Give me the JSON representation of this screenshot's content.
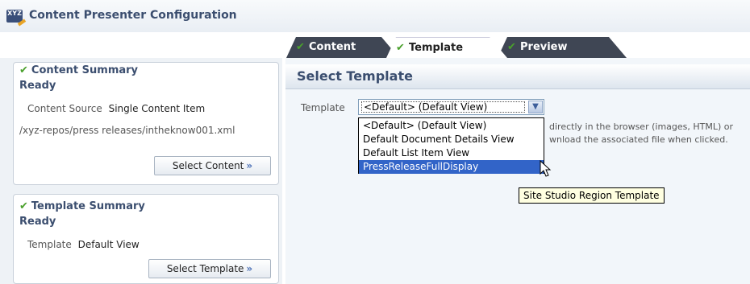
{
  "page": {
    "title": "Content Presenter Configuration",
    "icon": "xyz-pen-icon"
  },
  "tabs": [
    {
      "label": "Content",
      "state": "done"
    },
    {
      "label": "Template",
      "state": "active"
    },
    {
      "label": "Preview",
      "state": "done"
    }
  ],
  "content_summary": {
    "title": "Content Summary",
    "status": "Ready",
    "source_label": "Content Source",
    "source_value": "Single Content Item",
    "path": "/xyz-repos/press releases/intheknow001.xml",
    "button": "Select Content"
  },
  "template_summary": {
    "title": "Template Summary",
    "status": "Ready",
    "template_label": "Template",
    "template_value": "Default View",
    "button": "Select Template"
  },
  "main": {
    "section_title": "Select Template",
    "template_label": "Template",
    "selected_value": "<Default> (Default View)",
    "options": [
      "<Default> (Default View)",
      "Default Document Details View",
      "Default List Item View",
      "PressReleaseFullDisplay"
    ],
    "highlighted_option_index": 3,
    "description_line1": "directly in the browser (images, HTML) or",
    "description_line2": "wnload the associated file when clicked.",
    "tooltip": "Site Studio Region Template"
  },
  "colors": {
    "accent": "#3b4e6f",
    "check": "#4aa02c",
    "selection": "#3264c8",
    "tab_dark": "#3f4654"
  }
}
